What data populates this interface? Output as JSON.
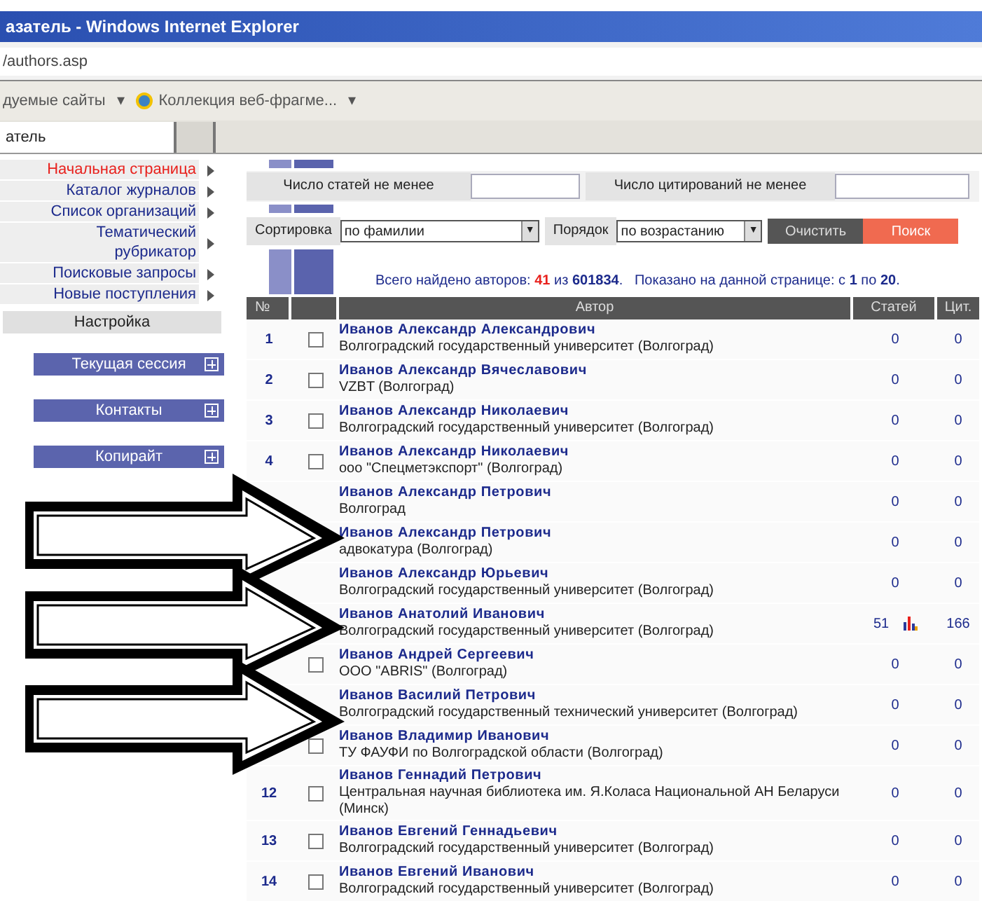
{
  "window": {
    "title": "азатель - Windows Internet Explorer"
  },
  "address_bar": {
    "value": "/authors.asp"
  },
  "favorites_bar": [
    {
      "label": "дуемые сайты",
      "caret": "▾",
      "kind": "text"
    },
    {
      "label": "Коллекция веб-фрагме...",
      "caret": "▾",
      "kind": "ie"
    }
  ],
  "tabs": [
    {
      "label": "атель",
      "selected": true
    },
    {
      "selected": false
    }
  ],
  "sidebar": {
    "items": [
      {
        "label": "Начальная страница",
        "selected": true
      },
      {
        "label": "Каталог журналов",
        "selected": false
      },
      {
        "label": "Список организаций",
        "selected": false
      },
      {
        "label": "Тематический рубрикатор",
        "selected": false
      },
      {
        "label": "Поисковые запросы",
        "selected": false
      },
      {
        "label": "Новые поступления",
        "selected": false
      }
    ],
    "settings": "Настройка",
    "panels": [
      {
        "label": "Текущая сессия",
        "expanded": false
      },
      {
        "label": "Контакты",
        "expanded": false
      },
      {
        "label": "Копирайт",
        "expanded": false
      }
    ]
  },
  "filters": {
    "articles_label": "Число статей не менее",
    "citations_label": "Число цитирований не менее",
    "sort_label": "Сортировка",
    "sort_value": "по фамилии",
    "sort_caret": "▼",
    "order_label": "Порядок",
    "order_value": "по возрастанию",
    "order_caret": "▼",
    "clear_button": "Очистить",
    "search_button": "Поиск"
  },
  "summary": {
    "found_label": "Всего найдено авторов:",
    "found": "41",
    "of": "из",
    "total": "601834",
    "total_end": ".",
    "shown_label": "Показано на данной странице: с",
    "from": "1",
    "to_label": "по",
    "to": "20",
    "to_end": "."
  },
  "table": {
    "columns": [
      "№",
      "",
      "Автор",
      "Статей",
      "Цит."
    ],
    "rows": [
      {
        "number": "1",
        "checked": false,
        "name": "Иванов Александр Александрович",
        "org": "Волгоградский государственный университет (Волгоград)",
        "articles": "0",
        "citations": "0"
      },
      {
        "number": "2",
        "checked": false,
        "name": "Иванов Александр Вячеславович",
        "org": "VZBT (Волгоград)",
        "articles": "0",
        "citations": "0"
      },
      {
        "number": "3",
        "checked": false,
        "name": "Иванов Александр Николаевич",
        "org": "Волгоградский государственный университет (Волгоград)",
        "articles": "0",
        "citations": "0"
      },
      {
        "number": "4",
        "checked": false,
        "name": "Иванов Александр Николаевич",
        "org": "ооо \"Спецметэкспорт\" (Волгоград)",
        "articles": "0",
        "citations": "0"
      },
      {
        "name": "Иванов Александр Петрович",
        "org": "Волгоград",
        "articles": "0",
        "citations": "0"
      },
      {
        "name": "Иванов Александр Петрович",
        "org": "адвокатура (Волгоград)",
        "articles": "0",
        "citations": "0"
      },
      {
        "name": "Иванов Александр Юрьевич",
        "org": "Волгоградский государственный университет (Волгоград)",
        "articles": "0",
        "citations": "0"
      },
      {
        "name": "Иванов Анатолий Иванович",
        "org": "Волгоградский государственный университет (Волгоград)",
        "articles": "51",
        "citations": "166",
        "chart": true
      },
      {
        "checked": false,
        "name": "Иванов Андрей Сергеевич",
        "org": "ООО \"ABRIS\" (Волгоград)",
        "articles": "0",
        "citations": "0"
      },
      {
        "name": "Иванов Василий Петрович",
        "org": "Волгоградский государственный технический университет (Волгоград)",
        "articles": "0",
        "citations": "0"
      },
      {
        "checked": false,
        "name": "Иванов Владимир Иванович",
        "org": "ТУ ФАУФИ по Волгоградской области (Волгоград)",
        "articles": "0",
        "citations": "0"
      },
      {
        "number": "12",
        "checked": false,
        "name": "Иванов Геннадий Петрович",
        "org": "Центральная научная библиотека им. Я.Коласа Национальной АН Беларуси (Минск)",
        "articles": "0",
        "citations": "0"
      },
      {
        "number": "13",
        "checked": false,
        "name": "Иванов Евгений Геннадьевич",
        "org": "Волгоградский государственный университет (Волгоград)",
        "articles": "0",
        "citations": "0"
      },
      {
        "number": "14",
        "checked": false,
        "name": "Иванов Евгений Иванович",
        "org": "Волгоградский государственный университет (Волгоград)",
        "articles": "0",
        "citations": "0"
      }
    ]
  }
}
